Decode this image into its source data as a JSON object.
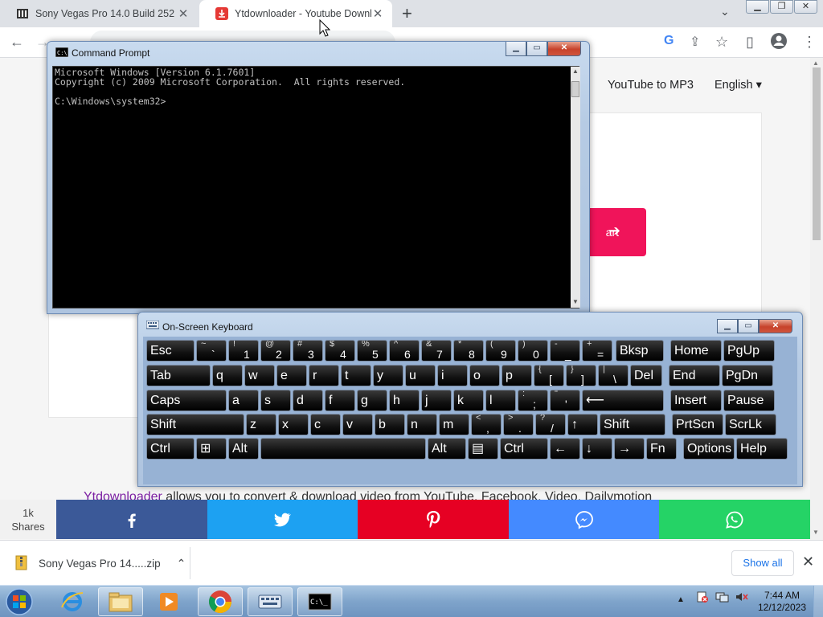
{
  "browser": {
    "tabs": [
      {
        "title": "Sony Vegas Pro 14.0 Build 252 +",
        "close": "✕"
      },
      {
        "title": "Ytdownloader - Youtube Downlo",
        "close": "✕"
      }
    ],
    "new_tab": "+",
    "tab_search": "⌄",
    "window_controls": {
      "minimize": "▁",
      "maximize": "❐",
      "close": "✕"
    },
    "toolbar": {
      "back": "←",
      "forward": "→",
      "menu": "⋮",
      "share": "⇪",
      "bookmark": "☆",
      "sidepanel": "▯",
      "google": "G"
    }
  },
  "website": {
    "nav": {
      "youtube_to_mp3": "YouTube to MP3",
      "language": "English ▾"
    },
    "start_button": "art",
    "start_arrow": "➔",
    "promo_brand": "Ytdownloader",
    "promo_text": " allows you to convert & download video from YouTube, Facebook, Video, Dailymotion"
  },
  "share_bar": {
    "count": "1k",
    "count_label": "Shares",
    "buttons": [
      {
        "name": "facebook",
        "color": "#3b5998"
      },
      {
        "name": "twitter",
        "color": "#1da1f2"
      },
      {
        "name": "pinterest",
        "color": "#e60023"
      },
      {
        "name": "messenger",
        "color": "#448aff"
      },
      {
        "name": "whatsapp",
        "color": "#25d366"
      }
    ]
  },
  "download_shelf": {
    "file": "Sony Vegas Pro 14.....zip",
    "chevron": "⌃",
    "show_all": "Show all",
    "close": "✕"
  },
  "cmd": {
    "title": "Command Prompt",
    "lines": "Microsoft Windows [Version 6.1.7601]\nCopyright (c) 2009 Microsoft Corporation.  All rights reserved.\n\nC:\\Windows\\system32>"
  },
  "osk": {
    "title": "On-Screen Keyboard",
    "rows": [
      [
        {
          "l": "Esc",
          "w": 60
        },
        {
          "t": "~",
          "b": "`",
          "w": 38
        },
        {
          "t": "!",
          "b": "1",
          "w": 38
        },
        {
          "t": "@",
          "b": "2",
          "w": 38
        },
        {
          "t": "#",
          "b": "3",
          "w": 38
        },
        {
          "t": "$",
          "b": "4",
          "w": 38
        },
        {
          "t": "%",
          "b": "5",
          "w": 38
        },
        {
          "t": "^",
          "b": "6",
          "w": 38
        },
        {
          "t": "&",
          "b": "7",
          "w": 38
        },
        {
          "t": "*",
          "b": "8",
          "w": 38
        },
        {
          "t": "(",
          "b": "9",
          "w": 38
        },
        {
          "t": ")",
          "b": "0",
          "w": 38
        },
        {
          "t": "-",
          "b": "_",
          "w": 38
        },
        {
          "t": "+",
          "b": "=",
          "w": 38
        },
        {
          "l": "Bksp",
          "w": 60,
          "gap": 2
        },
        {
          "l": "Home",
          "w": 64,
          "gap": 6
        },
        {
          "l": "PgUp",
          "w": 64
        }
      ],
      [
        {
          "l": "Tab",
          "w": 80
        },
        {
          "l": "q",
          "w": 38
        },
        {
          "l": "w",
          "w": 38
        },
        {
          "l": "e",
          "w": 38
        },
        {
          "l": "r",
          "w": 38
        },
        {
          "l": "t",
          "w": 38
        },
        {
          "l": "y",
          "w": 38
        },
        {
          "l": "u",
          "w": 38
        },
        {
          "l": "i",
          "w": 38
        },
        {
          "l": "o",
          "w": 38
        },
        {
          "l": "p",
          "w": 38
        },
        {
          "t": "{",
          "b": "[",
          "w": 38
        },
        {
          "t": "}",
          "b": "]",
          "w": 38
        },
        {
          "t": "|",
          "b": "\\",
          "w": 38
        },
        {
          "l": "Del",
          "w": 40
        },
        {
          "l": "End",
          "w": 64,
          "gap": 6
        },
        {
          "l": "PgDn",
          "w": 64
        }
      ],
      [
        {
          "l": "Caps",
          "w": 100
        },
        {
          "l": "a",
          "w": 38
        },
        {
          "l": "s",
          "w": 38
        },
        {
          "l": "d",
          "w": 38
        },
        {
          "l": "f",
          "w": 38
        },
        {
          "l": "g",
          "w": 38
        },
        {
          "l": "h",
          "w": 38
        },
        {
          "l": "j",
          "w": 38
        },
        {
          "l": "k",
          "w": 38
        },
        {
          "l": "l",
          "w": 38
        },
        {
          "t": ":",
          "b": ";",
          "w": 38
        },
        {
          "t": "\"",
          "b": "'",
          "w": 38
        },
        {
          "l": "⟵",
          "w": 102
        },
        {
          "l": "Insert",
          "w": 64,
          "gap": 6
        },
        {
          "l": "Pause",
          "w": 64
        }
      ],
      [
        {
          "l": "Shift",
          "w": 122
        },
        {
          "l": "z",
          "w": 38
        },
        {
          "l": "x",
          "w": 38
        },
        {
          "l": "c",
          "w": 38
        },
        {
          "l": "v",
          "w": 38
        },
        {
          "l": "b",
          "w": 38
        },
        {
          "l": "n",
          "w": 38
        },
        {
          "l": "m",
          "w": 38
        },
        {
          "t": "<",
          "b": ",",
          "w": 38
        },
        {
          "t": ">",
          "b": ".",
          "w": 38
        },
        {
          "t": "?",
          "b": "/",
          "w": 38
        },
        {
          "l": "↑",
          "w": 38
        },
        {
          "l": "Shift",
          "w": 82
        },
        {
          "l": "PrtScn",
          "w": 64,
          "gap": 6
        },
        {
          "l": "ScrLk",
          "w": 64
        }
      ],
      [
        {
          "l": "Ctrl",
          "w": 60
        },
        {
          "l": "⊞",
          "w": 38
        },
        {
          "l": "Alt",
          "w": 38
        },
        {
          "l": "",
          "w": 206
        },
        {
          "l": "Alt",
          "w": 48
        },
        {
          "l": "▤",
          "w": 38
        },
        {
          "l": "Ctrl",
          "w": 60
        },
        {
          "l": "←",
          "w": 38
        },
        {
          "l": "↓",
          "w": 38
        },
        {
          "l": "→",
          "w": 38
        },
        {
          "l": "Fn",
          "w": 38
        },
        {
          "l": "Options",
          "w": 64,
          "gap": 6
        },
        {
          "l": "Help",
          "w": 64
        }
      ]
    ]
  },
  "taskbar": {
    "time": "7:44 AM",
    "date": "12/12/2023",
    "tray_arrow": "▲"
  }
}
